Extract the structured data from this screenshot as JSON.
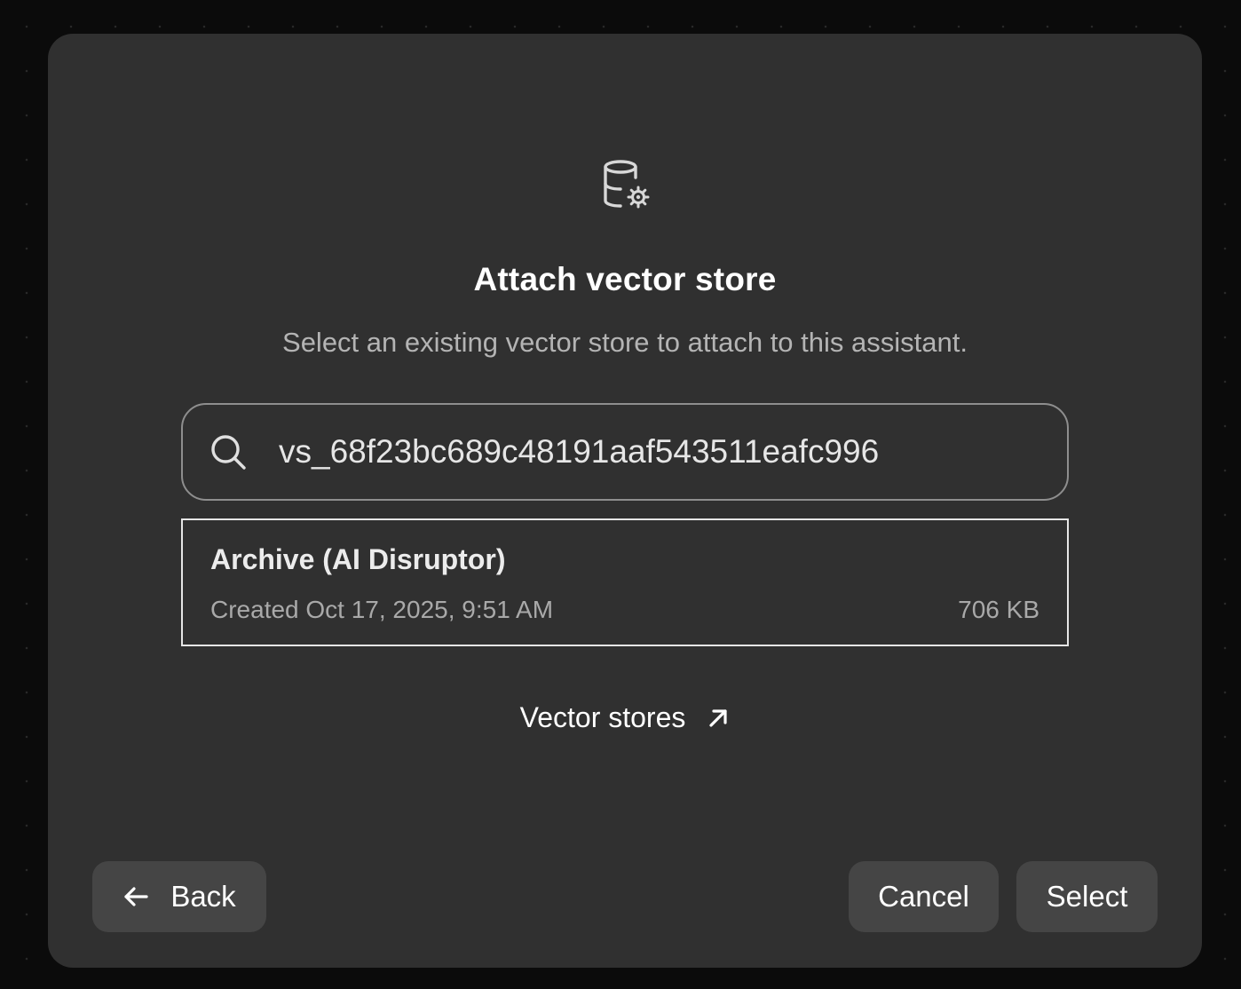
{
  "dialog": {
    "header_icon": "database-gear-icon",
    "title": "Attach vector store",
    "subtitle": "Select an existing vector store to attach to this assistant."
  },
  "search": {
    "icon": "search-icon",
    "value": "vs_68f23bc689c48191aaf543511eafc996",
    "placeholder": ""
  },
  "results": [
    {
      "name": "Archive (AI Disruptor)",
      "created": "Created Oct 17, 2025, 9:51 AM",
      "size": "706 KB"
    }
  ],
  "link": {
    "label": "Vector stores",
    "icon": "external-link-arrow-icon"
  },
  "footer": {
    "back_label": "Back",
    "back_icon": "arrow-left-icon",
    "cancel_label": "Cancel",
    "select_label": "Select"
  },
  "colors": {
    "background": "#0b0b0b",
    "modal": "#303030",
    "button": "#454545",
    "text_primary": "#ffffff",
    "text_secondary": "#b4b4b4"
  }
}
